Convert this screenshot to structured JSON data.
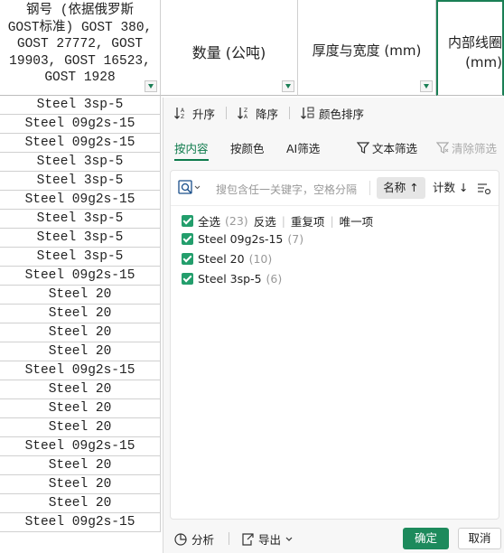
{
  "headers": {
    "col_a": "钢号 (依据俄罗斯\nGOST标准) GOST 380,\nGOST 27772, GOST\n19903, GOST 16523,\nGOST 1928",
    "col_b": "数量 (公吨)",
    "col_c": "厚度与宽度 (mm)",
    "col_d": "内部线圈\n(mm)"
  },
  "rows": [
    "Steel 3sp-5",
    "Steel 09g2s-15",
    "Steel 09g2s-15",
    "Steel 3sp-5",
    "Steel 3sp-5",
    "Steel 09g2s-15",
    "Steel 3sp-5",
    "Steel 3sp-5",
    "Steel 3sp-5",
    "Steel 09g2s-15",
    "Steel 20",
    "Steel 20",
    "Steel 20",
    "Steel 20",
    "Steel 09g2s-15",
    "Steel 20",
    "Steel 20",
    "Steel 20",
    "Steel 09g2s-15",
    "Steel 20",
    "Steel 20",
    "Steel 20",
    "Steel 09g2s-15"
  ],
  "sort": {
    "asc": "升序",
    "desc": "降序",
    "by_color": "颜色排序"
  },
  "tabs": {
    "content": "按内容",
    "color": "按颜色",
    "ai": "AI筛选",
    "text_filter": "文本筛选",
    "clear": "清除筛选"
  },
  "search": {
    "placeholder": "搜包含任一关键字，空格分隔",
    "name_sort": "名称 ↑",
    "count_sort": "计数 ↓"
  },
  "options": {
    "select_all": "全选",
    "select_all_count": "(23)",
    "invert": "反选",
    "duplicates": "重复项",
    "unique": "唯一项",
    "items": [
      {
        "label": "Steel 09g2s-15",
        "count": "(7)"
      },
      {
        "label": "Steel 20",
        "count": "(10)"
      },
      {
        "label": "Steel 3sp-5",
        "count": "(6)"
      }
    ]
  },
  "footer": {
    "analyze": "分析",
    "export": "导出",
    "ok": "确定",
    "cancel": "取消"
  },
  "colors": {
    "accent": "#1d8a5c",
    "checkbox": "#239e6c"
  }
}
